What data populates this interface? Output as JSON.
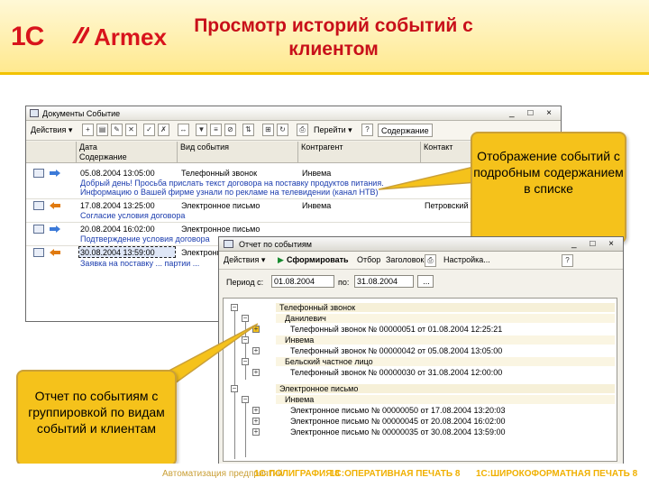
{
  "header": {
    "logo_1c": "1C",
    "logo_armex": "Armex",
    "title": "Просмотр историй событий с клиентом"
  },
  "window1": {
    "title": "Документы Событие",
    "buttons": [
      "_ □ ×"
    ],
    "toolbar": {
      "actions": "Действия ▾",
      "go": "Перейти ▾",
      "content": "Содержание"
    },
    "columns": {
      "date": "Дата",
      "content": "Содержание",
      "kind": "Вид события",
      "counterparty": "Контрагент",
      "contact": "Контакт"
    },
    "rows": [
      {
        "date": "05.08.2004 13:05:00",
        "kind": "Телефонный звонок",
        "counterparty": "Инвема",
        "line1": "Добрый день! Просьба прислать текст договора на поставку продуктов питания.",
        "line2": "Информацию о Вашей фирме узнали по рекламе на телевидении (канал НТВ)"
      },
      {
        "date": "17.08.2004 13:25:00",
        "kind": "Электронное письмо",
        "counterparty": "Инвема",
        "contact": "Петровский",
        "line1": "Согласие условия договора"
      },
      {
        "date": "20.08.2004 16:02:00",
        "kind": "Электронное письмо",
        "counterparty": "",
        "line1": "Подтверждение условия договора"
      },
      {
        "date": "30.08.2004 13:59:00",
        "kind": "Электронное письмо",
        "counterparty": "",
        "line1": "Заявка на поставку ... партии ..."
      }
    ]
  },
  "window2": {
    "title": "Отчет по событиям",
    "buttons": "_ □ ×",
    "toolbar": {
      "actions": "Действия ▾",
      "generate": "Сформировать",
      "filter": "Отбор",
      "header": "Заголовок",
      "settings": "Настройка..."
    },
    "period_label": "Период с:",
    "period_from": "01.08.2004",
    "period_to_label": "по:",
    "period_to": "31.08.2004",
    "more": "...",
    "report_rows": [
      {
        "level": 1,
        "text": "Телефонный звонок"
      },
      {
        "level": 2,
        "text": "Данилевич"
      },
      {
        "level": 3,
        "text": "Телефонный звонок № 00000051 от 01.08.2004 12:25:21"
      },
      {
        "level": 2,
        "text": "Инвема"
      },
      {
        "level": 3,
        "text": "Телефонный звонок № 00000042 от 05.08.2004 13:05:00"
      },
      {
        "level": 2,
        "text": "Бельский частное лицо"
      },
      {
        "level": 3,
        "text": "Телефонный звонок № 00000030 от 31.08.2004 12:00:00"
      },
      {
        "level": 1,
        "text": "Электронное письмо"
      },
      {
        "level": 2,
        "text": "Инвема"
      },
      {
        "level": 3,
        "text": "Электронное письмо № 00000050 от 17.08.2004 13:20:03"
      },
      {
        "level": 3,
        "text": "Электронное письмо № 00000045 от 20.08.2004 16:02:00"
      },
      {
        "level": 3,
        "text": "Электронное письмо № 00000035 от 30.08.2004 13:59:00"
      }
    ]
  },
  "callouts": {
    "list_content": "Отображение событий с подробным содержанием в списке",
    "report_grouping": "Отчет по событиям с группировкой по видам событий и клиентам"
  },
  "footer": {
    "left": "Автоматизация предприятий",
    "items": [
      "1С:ПОЛИГРАФИЯ 8",
      "1С:ОПЕРАТИВНАЯ ПЕЧАТЬ 8",
      "1С:ШИРОКОФОРМАТНАЯ ПЕЧАТЬ 8"
    ]
  },
  "colors": {
    "brand_red": "#d8141c",
    "callout_yellow": "#f5c21b",
    "footer_gold": "#f0b000",
    "link_blue": "#1b3cae"
  }
}
